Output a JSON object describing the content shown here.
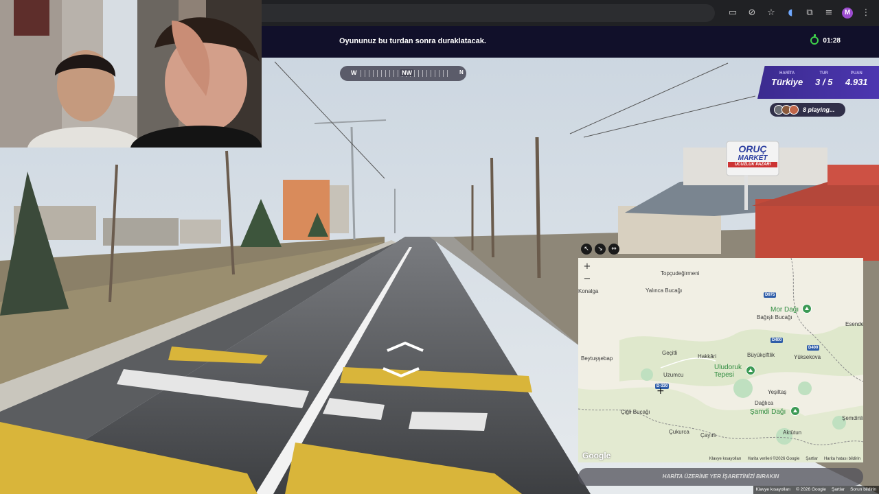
{
  "browser": {
    "icons": [
      "cast-icon",
      "eye-off-icon",
      "star-icon",
      "audio-icon",
      "extensions-icon",
      "media-icon",
      "profile-icon",
      "menu-icon"
    ],
    "profile_initial": "M"
  },
  "game": {
    "notice": "Oyununuz bu turdan sonra duraklatacak.",
    "timer": "01:28",
    "compass": {
      "left": "W",
      "center": "NW",
      "right": "N"
    },
    "stats": [
      {
        "label": "HARİTA",
        "value": "Türkiye"
      },
      {
        "label": "TUR",
        "value": "3 / 5"
      },
      {
        "label": "PUAN",
        "value": "4.931"
      }
    ],
    "players_text": "8 playing...",
    "guess_button": "HARİTA ÜZERİNE YER İŞARETİNİZİ BIRAKIN"
  },
  "scene": {
    "shop_sign_top": "ORUÇ",
    "shop_sign_mid": "MARKET",
    "shop_sign_bottom": "UCUZLUK PAZARI"
  },
  "map": {
    "labels": [
      "Topçudeğirmeni",
      "Konalga",
      "Yalınca Bucağı",
      "Bağışlı Bucağı",
      "Esende",
      "Beytuşşebap",
      "Geçitli",
      "Hakkâri",
      "Büyükçiftlik",
      "Yüksekova",
      "Uzumcu",
      "Yeşiltaş",
      "Dağlıca",
      "Çiğli Bucağı",
      "Çukurca",
      "Çayırlı",
      "Aktütun",
      "Şemdinli"
    ],
    "peaks": [
      "Mor Dağı",
      "Uludoruk Tepesi",
      "Şamdi Dağı"
    ],
    "roads": [
      "D975",
      "D400",
      "D400",
      "D-330"
    ],
    "google": "Google",
    "footer": [
      "Klavye kısayolları",
      "Harita verileri ©2026 Google",
      "Şartlar",
      "Harita hatası bildirin"
    ],
    "zoom_in": "+",
    "zoom_out": "−"
  },
  "page_footer": [
    "Klavye kısayolları",
    "© 2026 Google",
    "Şartlar",
    "Sorun bildirin"
  ]
}
